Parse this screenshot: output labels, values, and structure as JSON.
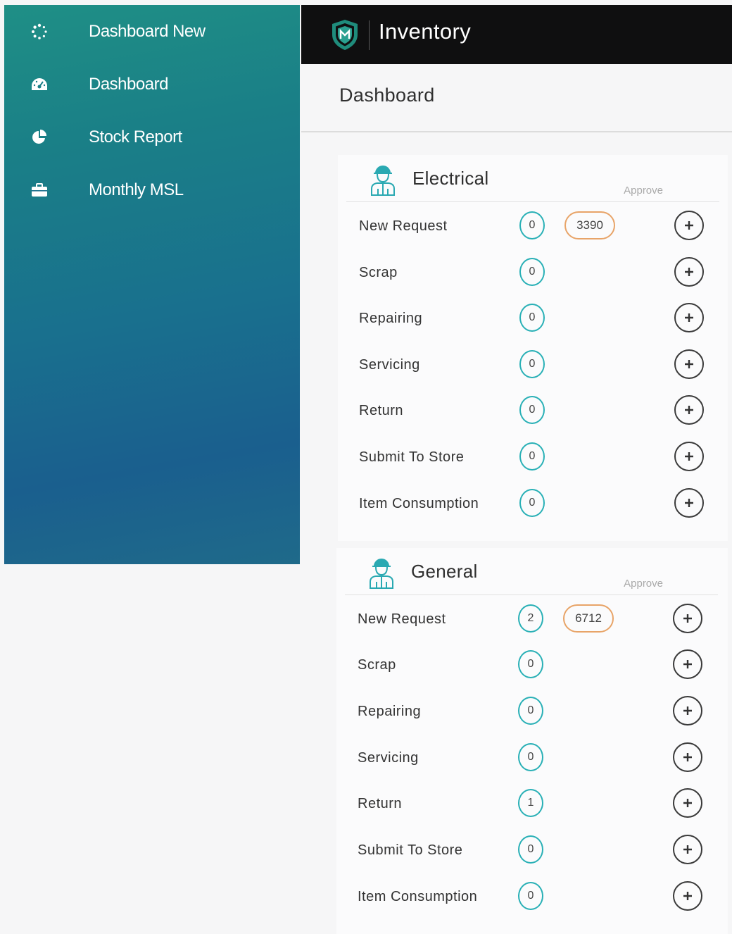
{
  "sidebar": {
    "items": [
      {
        "label": "Dashboard New",
        "icon": "spinner-icon"
      },
      {
        "label": "Dashboard",
        "icon": "tachometer-icon"
      },
      {
        "label": "Stock Report",
        "icon": "pie-chart-icon"
      },
      {
        "label": "Monthly MSL",
        "icon": "briefcase-icon"
      }
    ]
  },
  "header": {
    "title": "Inventory",
    "logo": "shield-logo"
  },
  "page": {
    "title": "Dashboard"
  },
  "colors": {
    "accent_teal": "#29b0b6",
    "pending_orange": "#e8a468",
    "topbar": "#0f0f10"
  },
  "cards": {
    "electrical": {
      "title": "Electrical",
      "approve_label": "Approve",
      "rows": [
        {
          "label": "New Request",
          "count": "0",
          "approve": "3390"
        },
        {
          "label": "Scrap",
          "count": "0"
        },
        {
          "label": "Repairing",
          "count": "0"
        },
        {
          "label": "Servicing",
          "count": "0"
        },
        {
          "label": "Return",
          "count": "0"
        },
        {
          "label": "Submit To Store",
          "count": "0"
        },
        {
          "label": "Item Consumption",
          "count": "0"
        }
      ]
    },
    "general": {
      "title": "General",
      "approve_label": "Approve",
      "rows": [
        {
          "label": "New Request",
          "count": "2",
          "approve": "6712"
        },
        {
          "label": "Scrap",
          "count": "0"
        },
        {
          "label": "Repairing",
          "count": "0"
        },
        {
          "label": "Servicing",
          "count": "0"
        },
        {
          "label": "Return",
          "count": "1"
        },
        {
          "label": "Submit To Store",
          "count": "0"
        },
        {
          "label": "Item Consumption",
          "count": "0"
        }
      ]
    }
  }
}
